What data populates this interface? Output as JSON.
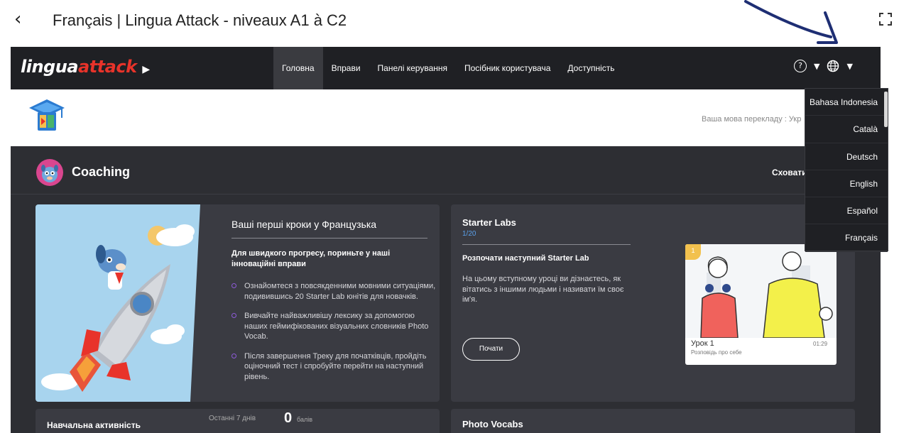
{
  "topbar": {
    "title": "Français | Lingua Attack - niveaux A1 à C2"
  },
  "navbar": {
    "logo_main": "lingua",
    "logo_accent": "attack",
    "items": [
      {
        "label": "Головна",
        "active": true
      },
      {
        "label": "Вправи",
        "active": false
      },
      {
        "label": "Панелі керування",
        "active": false
      },
      {
        "label": "Посібник користувача",
        "active": false
      },
      {
        "label": "Доступність",
        "active": false
      }
    ]
  },
  "subheader": {
    "translate_language": "Ваша мова перекладу : Укр"
  },
  "coaching": {
    "title": "Coaching",
    "hide_label": "Сховати"
  },
  "first_steps": {
    "title": "Ваші перші кроки у Французька",
    "subtitle": "Для швидкого прогресу, пориньте у наші інноваційні вправи",
    "bullets": [
      "Ознайомтеся з повсякденними мовними ситуаціями, подивившись 20 Starter Lab юнітів для новачків.",
      "Вивчайте найважливішу лексику за допомогою наших геймифікованих візуальних словників Photo Vocab.",
      "Після завершення Треку для початківців, пройдіть оціночний тест і спробуйте перейти на наступний рівень."
    ]
  },
  "starter_labs": {
    "title": "Starter Labs",
    "count": "1/20",
    "subtitle": "Розпочати наступний Starter Lab",
    "description": "На цьому вступному уроці ви дізнаєтесь, як вітатись з іншими людьми і називати їм своє ім'я.",
    "start_label": "Почати",
    "lesson": {
      "number": "1",
      "title": "Урок 1",
      "subtitle": "Розповідь про себе",
      "duration": "01:29"
    }
  },
  "activity": {
    "title": "Навчальна активність",
    "period": "Останні 7 днів",
    "points": "0",
    "points_label": "балів"
  },
  "photo_vocabs": {
    "title": "Photo Vocabs"
  },
  "language_menu": {
    "items": [
      "Bahasa Indonesia",
      "Català",
      "Deutsch",
      "English",
      "Español",
      "Français"
    ]
  },
  "colors": {
    "navbar": "#1f2024",
    "panel": "#2d2e33",
    "card": "#3a3b42",
    "accent_red": "#e8332a",
    "accent_blue": "#5aa0ea",
    "bullet_purple": "#8d5bd8",
    "annotation_arrow": "#1e2e73"
  }
}
